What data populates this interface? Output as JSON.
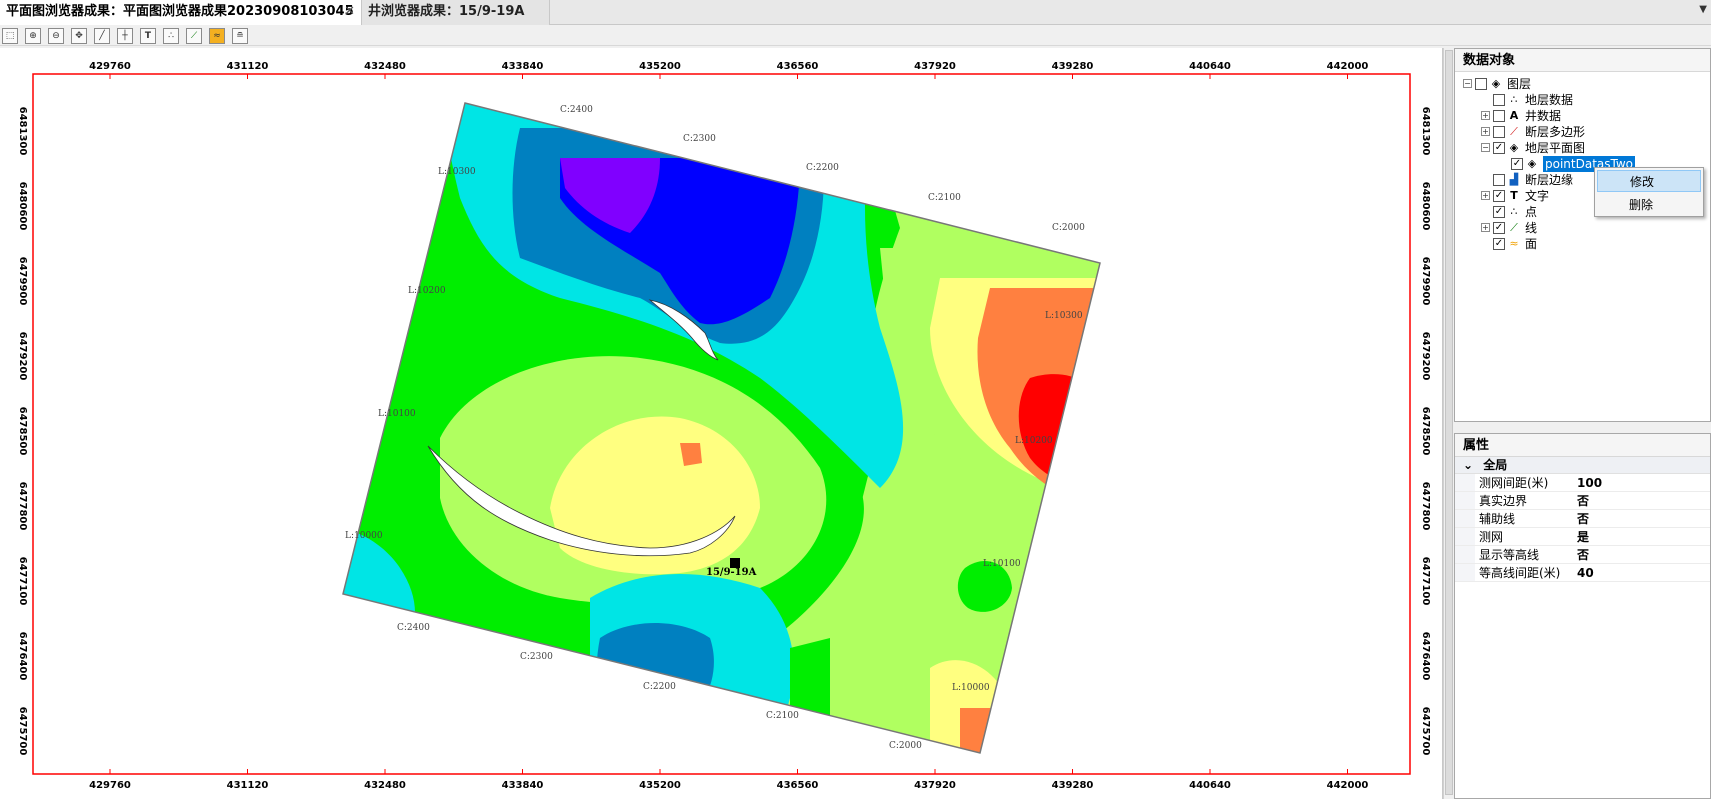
{
  "tabs": [
    {
      "label": "平面图浏览器成果：平面图浏览器成果20230908103045",
      "close": "✕"
    },
    {
      "label": "井浏览器成果：15/9-19A"
    }
  ],
  "toolbar_icons": [
    "select-icon",
    "zoom-in-icon",
    "zoom-out-icon",
    "pan-icon",
    "line-tool-icon",
    "grid-icon",
    "text-tool-icon",
    "points-tool-icon",
    "polyline-tool-icon",
    "surface-tool-icon",
    "layers-tool-icon"
  ],
  "map": {
    "x_ticks": [
      "429760",
      "431120",
      "432480",
      "433840",
      "435200",
      "436560",
      "437920",
      "439280",
      "440640",
      "442000"
    ],
    "y_ticks": [
      "6481300",
      "6480600",
      "6479900",
      "6479200",
      "6478500",
      "6477800",
      "6477100",
      "6476400",
      "6475700"
    ],
    "contour_c": [
      "C:2400",
      "C:2300",
      "C:2200",
      "C:2100",
      "C:2000"
    ],
    "contour_c_bottom": [
      "C:2400",
      "C:2300",
      "C:2200",
      "C:2100",
      "C:2000"
    ],
    "contour_l_left": [
      "L:10300",
      "L:10200",
      "L:10100",
      "L:10000"
    ],
    "contour_l_right": [
      "L:10300",
      "L:10200",
      "L:10100",
      "L:10000"
    ],
    "well_label": "15/9-19A",
    "colors": {
      "frame": "#ff0000",
      "cyan": "#00e5e5",
      "blue": "#0000ff",
      "violet": "#8000ff",
      "steel": "#0080c0",
      "green": "#00ee00",
      "lightgreen": "#b0ff60",
      "yellow": "#ffff80",
      "orange": "#ff8040",
      "red": "#ff0000"
    }
  },
  "data_panel": {
    "title": "数据对象",
    "tree": [
      {
        "label": "图层",
        "expander": "⊟",
        "checked": false
      },
      {
        "label": "地层数据",
        "checked": false
      },
      {
        "label": "井数据",
        "expander": "⊞",
        "checked": false
      },
      {
        "label": "断层多边形",
        "expander": "⊞",
        "checked": false
      },
      {
        "label": "地层平面图",
        "expander": "⊟",
        "checked": true
      },
      {
        "label": "pointDatasTwo",
        "checked": true
      },
      {
        "label": "断层边缘",
        "checked": false
      },
      {
        "label": "文字",
        "expander": "⊞",
        "checked": true
      },
      {
        "label": "点",
        "checked": true
      },
      {
        "label": "线",
        "expander": "⊞",
        "checked": true
      },
      {
        "label": "面",
        "checked": true
      }
    ],
    "context_menu": {
      "edit": "修改",
      "delete": "删除"
    }
  },
  "props_panel": {
    "title": "属性",
    "group": "全局",
    "rows": [
      {
        "key": "测网间距(米)",
        "value": "100"
      },
      {
        "key": "真实边界",
        "value": "否"
      },
      {
        "key": "辅助线",
        "value": "否"
      },
      {
        "key": "测网",
        "value": "是"
      },
      {
        "key": "显示等高线",
        "value": "否"
      },
      {
        "key": "等高线间距(米)",
        "value": "40"
      }
    ]
  }
}
